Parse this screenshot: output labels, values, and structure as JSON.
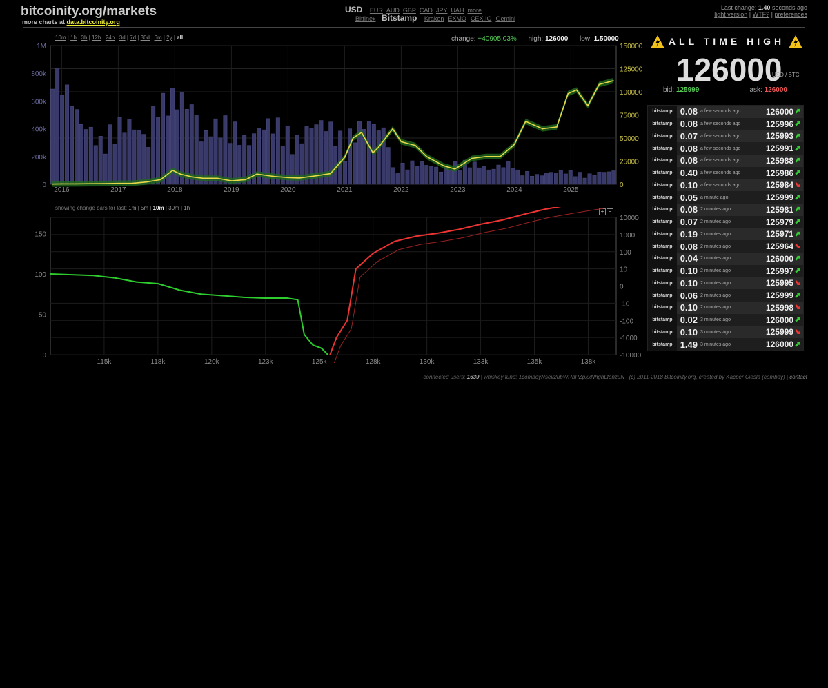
{
  "header": {
    "title": "bitcoinity.org/markets",
    "sub_prefix": "more charts at",
    "sub_link": "data.bitcoinity.org",
    "currency_active": "USD",
    "currencies": [
      "EUR",
      "AUD",
      "GBP",
      "CAD",
      "JPY",
      "UAH",
      "more"
    ],
    "exchanges_before": [
      "Bitfinex"
    ],
    "exchange_active": "Bitstamp",
    "exchanges_after": [
      "Kraken",
      "EXMO",
      "CEX.IO",
      "Gemini"
    ],
    "last_change_label": "Last change:",
    "last_change_value": "1.40",
    "last_change_suffix": "seconds ago",
    "links": [
      "light version",
      "WTF?",
      "preferences"
    ]
  },
  "main_chart": {
    "ranges": [
      "10m",
      "1h",
      "3h",
      "12h",
      "24h",
      "3d",
      "7d",
      "30d",
      "6m",
      "2y",
      "all"
    ],
    "selected_range": "all",
    "change_label": "change:",
    "change_value": "+40905.03%",
    "high_label": "high:",
    "high_value": "126000",
    "low_label": "low:",
    "low_value": "1.50000"
  },
  "chart_data": [
    {
      "type": "line",
      "title": "",
      "x": [
        2015.83,
        2016.0,
        2016.25,
        2016.5,
        2016.75,
        2017.0,
        2017.25,
        2017.5,
        2017.75,
        2017.96,
        2018.1,
        2018.3,
        2018.5,
        2018.75,
        2019.0,
        2019.25,
        2019.45,
        2019.75,
        2020.0,
        2020.2,
        2020.5,
        2020.75,
        2021.0,
        2021.15,
        2021.3,
        2021.5,
        2021.6,
        2021.85,
        2022.0,
        2022.25,
        2022.45,
        2022.75,
        2022.95,
        2023.25,
        2023.5,
        2023.75,
        2024.0,
        2024.2,
        2024.5,
        2024.75,
        2024.95,
        2025.1,
        2025.3,
        2025.5,
        2025.75
      ],
      "series": [
        {
          "values": [
            250,
            420,
            440,
            650,
            700,
            1000,
            1100,
            2500,
            5000,
            15000,
            11000,
            8000,
            6500,
            6500,
            3700,
            5000,
            11000,
            8500,
            7200,
            6800,
            9200,
            11500,
            29000,
            50000,
            56000,
            34000,
            40000,
            60000,
            46000,
            42000,
            30000,
            20000,
            16500,
            28000,
            30000,
            30000,
            43000,
            68000,
            60000,
            62000,
            98000,
            102000,
            85000,
            108000,
            112000
          ]
        }
      ],
      "xlabel": "",
      "ylabel": "",
      "xlim": [
        2015.8,
        2025.8
      ],
      "ylim": [
        0,
        150000
      ],
      "x_ticks": [
        "2016",
        "2017",
        "2018",
        "2019",
        "2020",
        "2021",
        "2022",
        "2023",
        "2024",
        "2025"
      ],
      "y_right_ticks": [
        "0",
        "25000",
        "50000",
        "75000",
        "100000",
        "125000",
        "150000"
      ],
      "y_left_ticks": [
        "0",
        "200k",
        "400k",
        "600k",
        "800k",
        "1M"
      ],
      "grid": true
    },
    {
      "type": "line",
      "title": "",
      "x_ticks": [
        "115k",
        "118k",
        "120k",
        "123k",
        "125k",
        "128k",
        "130k",
        "133k",
        "135k",
        "138k"
      ],
      "y_left_ticks": [
        "0",
        "50",
        "100",
        "150"
      ],
      "y_right_ticks": [
        "10000",
        "1000",
        "100",
        "10",
        "0",
        "-10",
        "-100",
        "-1000",
        "-10000"
      ],
      "series": [
        {
          "name": "bids",
          "x": [
            113,
            114,
            115,
            116,
            117,
            118,
            119,
            120,
            121,
            122,
            123,
            124,
            124.5,
            124.8,
            125.2,
            125.6,
            125.9
          ],
          "values": [
            100,
            99,
            98,
            95,
            90,
            88,
            80,
            75,
            73,
            71,
            70,
            70,
            68,
            25,
            12,
            8,
            0
          ]
        },
        {
          "name": "asks",
          "x": [
            126.0,
            126.3,
            126.8,
            127.2,
            128,
            129,
            130,
            131,
            132,
            133,
            134,
            135,
            136,
            137,
            138,
            138.5
          ],
          "values": [
            -1000,
            -100,
            -10,
            1,
            8,
            40,
            80,
            120,
            200,
            400,
            700,
            1500,
            3000,
            5000,
            8000,
            10000
          ]
        }
      ],
      "grid": true
    }
  ],
  "change_bars": {
    "label": "showing change bars for last:",
    "options": [
      "1m",
      "5m",
      "10m",
      "30m",
      "1h"
    ],
    "selected": "10m",
    "zoom_in": "+",
    "zoom_out": "−"
  },
  "ath": {
    "title": "ALL TIME HIGH",
    "price": "126000",
    "unit": "USD / BTC",
    "bid_label": "bid:",
    "bid": "125999",
    "ask_label": "ask:",
    "ask": "126000"
  },
  "trades": [
    {
      "ex": "bitstamp",
      "amt": "0.08",
      "time": "a few seconds ago",
      "price": "126000",
      "dir": "up"
    },
    {
      "ex": "bitstamp",
      "amt": "0.08",
      "time": "a few seconds ago",
      "price": "125996",
      "dir": "up"
    },
    {
      "ex": "bitstamp",
      "amt": "0.07",
      "time": "a few seconds ago",
      "price": "125993",
      "dir": "up"
    },
    {
      "ex": "bitstamp",
      "amt": "0.08",
      "time": "a few seconds ago",
      "price": "125991",
      "dir": "up"
    },
    {
      "ex": "bitstamp",
      "amt": "0.08",
      "time": "a few seconds ago",
      "price": "125988",
      "dir": "up"
    },
    {
      "ex": "bitstamp",
      "amt": "0.40",
      "time": "a few seconds ago",
      "price": "125986",
      "dir": "up"
    },
    {
      "ex": "bitstamp",
      "amt": "0.10",
      "time": "a few seconds ago",
      "price": "125984",
      "dir": "down"
    },
    {
      "ex": "bitstamp",
      "amt": "0.05",
      "time": "a minute ago",
      "price": "125999",
      "dir": "up"
    },
    {
      "ex": "bitstamp",
      "amt": "0.08",
      "time": "2 minutes ago",
      "price": "125981",
      "dir": "up"
    },
    {
      "ex": "bitstamp",
      "amt": "0.07",
      "time": "2 minutes ago",
      "price": "125979",
      "dir": "up"
    },
    {
      "ex": "bitstamp",
      "amt": "0.19",
      "time": "2 minutes ago",
      "price": "125971",
      "dir": "up"
    },
    {
      "ex": "bitstamp",
      "amt": "0.08",
      "time": "2 minutes ago",
      "price": "125964",
      "dir": "down"
    },
    {
      "ex": "bitstamp",
      "amt": "0.04",
      "time": "2 minutes ago",
      "price": "126000",
      "dir": "up"
    },
    {
      "ex": "bitstamp",
      "amt": "0.10",
      "time": "2 minutes ago",
      "price": "125997",
      "dir": "up"
    },
    {
      "ex": "bitstamp",
      "amt": "0.10",
      "time": "2 minutes ago",
      "price": "125995",
      "dir": "down"
    },
    {
      "ex": "bitstamp",
      "amt": "0.06",
      "time": "2 minutes ago",
      "price": "125999",
      "dir": "up"
    },
    {
      "ex": "bitstamp",
      "amt": "0.10",
      "time": "2 minutes ago",
      "price": "125998",
      "dir": "down"
    },
    {
      "ex": "bitstamp",
      "amt": "0.02",
      "time": "3 minutes ago",
      "price": "126000",
      "dir": "up"
    },
    {
      "ex": "bitstamp",
      "amt": "0.10",
      "time": "3 minutes ago",
      "price": "125999",
      "dir": "down"
    },
    {
      "ex": "bitstamp",
      "amt": "1.49",
      "time": "3 minutes ago",
      "price": "126000",
      "dir": "up"
    }
  ],
  "footer": {
    "users_label": "connected users:",
    "users": "1639",
    "rest": "| whiskey fund: 1comboyNsev2ubWRbPZpxxNhghLfonzuN | (c) 2011-2018 Bitcoinity.org, created by Kacper Cieśla (comboy) |",
    "contact": "contact"
  },
  "colors": {
    "up": "#33cc33",
    "down": "#ee3333",
    "price_line": "#e8d84a",
    "volume": "#3a3a6a",
    "accent_link": "#eeee33"
  }
}
